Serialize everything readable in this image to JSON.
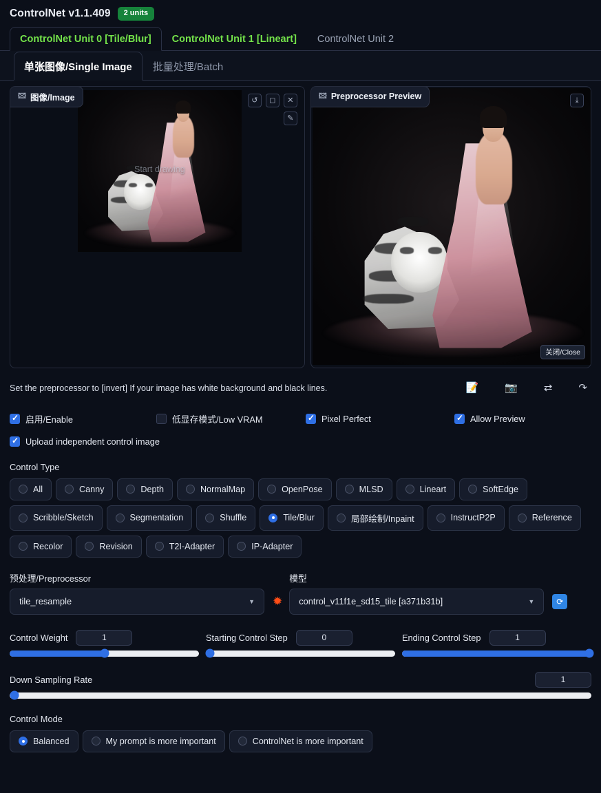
{
  "header": {
    "title": "ControlNet v1.1.409",
    "units_badge": "2 units"
  },
  "unit_tabs": [
    {
      "label": "ControlNet Unit 0 [Tile/Blur]",
      "state": "active"
    },
    {
      "label": "ControlNet Unit 1 [Lineart]",
      "state": "inactive-green"
    },
    {
      "label": "ControlNet Unit 2",
      "state": "plain"
    }
  ],
  "sub_tabs": [
    {
      "label": "单张图像/Single Image",
      "active": true
    },
    {
      "label": "批量处理/Batch",
      "active": false
    }
  ],
  "image_pane": {
    "left_tag": "图像/Image",
    "left_tag_icon": "image-icon",
    "right_tag": "Preprocessor Preview",
    "right_tag_icon": "image-icon",
    "start_drawing": "Start drawing",
    "close_chip": "关闭/Close",
    "tools": [
      {
        "name": "undo-icon",
        "glyph": "↺"
      },
      {
        "name": "eraser-icon",
        "glyph": "◻"
      },
      {
        "name": "close-icon",
        "glyph": "✕"
      },
      {
        "name": "brush-icon",
        "glyph": "✎"
      }
    ],
    "download_icon": "⤓"
  },
  "hint": {
    "text": "Set the preprocessor to [invert] If your image has white background and black lines.",
    "icons": [
      {
        "name": "edit-document-icon",
        "glyph": "📝"
      },
      {
        "name": "camera-icon",
        "glyph": "📷"
      },
      {
        "name": "swap-icon",
        "glyph": "⇄"
      },
      {
        "name": "send-arrow-icon",
        "glyph": "↷"
      }
    ]
  },
  "checkboxes": {
    "row1": [
      {
        "label": "启用/Enable",
        "checked": true
      },
      {
        "label": "低显存模式/Low VRAM",
        "checked": false
      },
      {
        "label": "Pixel Perfect",
        "checked": true
      },
      {
        "label": "Allow Preview",
        "checked": true
      }
    ],
    "row2": [
      {
        "label": "Upload independent control image",
        "checked": true
      }
    ]
  },
  "control_type": {
    "label": "Control Type",
    "rows": [
      [
        {
          "label": "All",
          "selected": false
        },
        {
          "label": "Canny",
          "selected": false
        },
        {
          "label": "Depth",
          "selected": false
        },
        {
          "label": "NormalMap",
          "selected": false
        },
        {
          "label": "OpenPose",
          "selected": false
        },
        {
          "label": "MLSD",
          "selected": false
        },
        {
          "label": "Lineart",
          "selected": false
        },
        {
          "label": "SoftEdge",
          "selected": false
        }
      ],
      [
        {
          "label": "Scribble/Sketch",
          "selected": false
        },
        {
          "label": "Segmentation",
          "selected": false
        },
        {
          "label": "Shuffle",
          "selected": false
        },
        {
          "label": "Tile/Blur",
          "selected": true
        },
        {
          "label": "局部绘制/Inpaint",
          "selected": false
        },
        {
          "label": "InstructP2P",
          "selected": false
        },
        {
          "label": "Reference",
          "selected": false
        }
      ],
      [
        {
          "label": "Recolor",
          "selected": false
        },
        {
          "label": "Revision",
          "selected": false
        },
        {
          "label": "T2I-Adapter",
          "selected": false
        },
        {
          "label": "IP-Adapter",
          "selected": false
        }
      ]
    ]
  },
  "preprocessor": {
    "label": "预处理/Preprocessor",
    "value": "tile_resample",
    "run_icon": "spark-icon"
  },
  "model": {
    "label": "模型",
    "value": "control_v11f1e_sd15_tile [a371b31b]",
    "refresh_icon": "refresh-icon"
  },
  "sliders": {
    "control_weight": {
      "label": "Control Weight",
      "value": "1",
      "percent": 50
    },
    "starting_step": {
      "label": "Starting Control Step",
      "value": "0",
      "percent": 0
    },
    "ending_step": {
      "label": "Ending Control Step",
      "value": "1",
      "percent": 100
    },
    "down_sampling_rate": {
      "label": "Down Sampling Rate",
      "value": "1",
      "percent": 0
    }
  },
  "control_mode": {
    "label": "Control Mode",
    "options": [
      {
        "label": "Balanced",
        "selected": true
      },
      {
        "label": "My prompt is more important",
        "selected": false
      },
      {
        "label": "ControlNet is more important",
        "selected": false
      }
    ]
  },
  "colors": {
    "accent_blue": "#2f6fe4",
    "accent_green": "#74e34a",
    "badge_green": "#16833b",
    "spark_orange": "#ff4d16",
    "background": "#0b0f19"
  }
}
